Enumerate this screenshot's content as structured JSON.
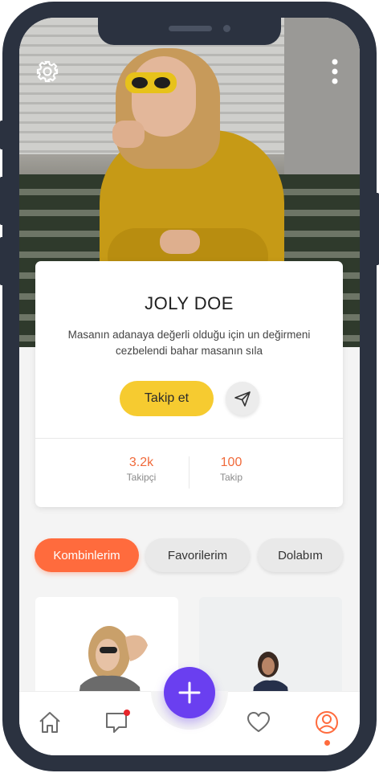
{
  "profile": {
    "name": "JOLY DOE",
    "bio": "Masanın adanaya değerli olduğu için un değirmeni cezbelendi bahar masanın sıla",
    "follow_label": "Takip et",
    "stats": [
      {
        "value": "3.2k",
        "label": "Takipçi"
      },
      {
        "value": "100",
        "label": "Takip"
      }
    ]
  },
  "tabs": [
    {
      "label": "Kombinlerim",
      "active": true
    },
    {
      "label": "Favorilerim",
      "active": false
    },
    {
      "label": "Dolabım",
      "active": false
    }
  ],
  "icons": {
    "settings": "gear-icon",
    "menu": "kebab-menu-icon",
    "send": "send-icon",
    "home": "home-icon",
    "messages": "chat-icon",
    "add": "plus-icon",
    "favorites": "heart-icon",
    "profile": "user-icon"
  },
  "colors": {
    "accent": "#ff6b3d",
    "follow": "#f6cb30",
    "fab": "#6a3ff0",
    "phone_frame": "#2b3240",
    "notification": "#e8262b"
  }
}
